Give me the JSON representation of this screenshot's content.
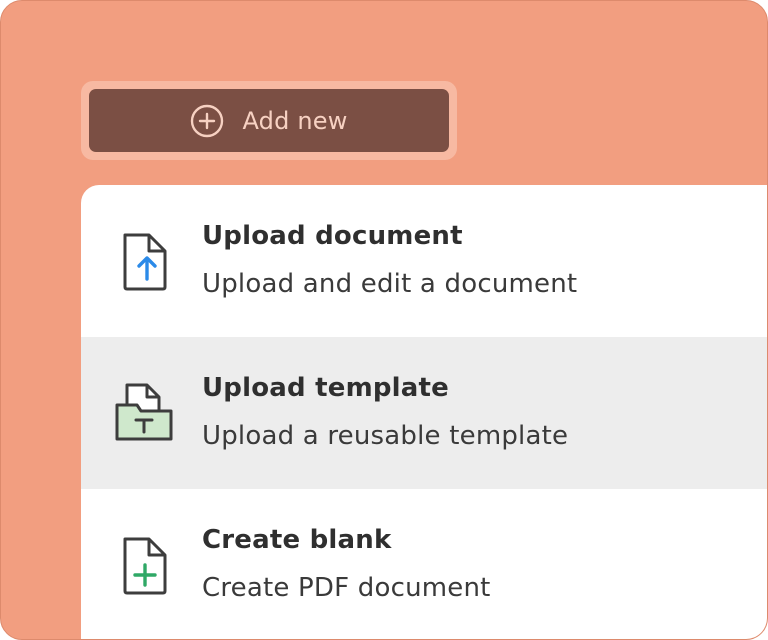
{
  "add_button": {
    "label": "Add new",
    "icon": "plus-circle-icon"
  },
  "menu": {
    "items": [
      {
        "title": "Upload document",
        "description": "Upload and edit a document",
        "icon": "file-upload-icon",
        "accent": "#2b8ae8"
      },
      {
        "title": "Upload template",
        "description": "Upload a reusable template",
        "icon": "template-folder-icon",
        "accent": "#cfe8cc",
        "highlighted": true
      },
      {
        "title": "Create blank",
        "description": "Create PDF document",
        "icon": "file-plus-icon",
        "accent": "#2fa866"
      }
    ]
  },
  "colors": {
    "background": "#f29e80",
    "button": "#7b4f44",
    "button_text": "#f7d1c2",
    "highlight_row": "#ededed"
  }
}
